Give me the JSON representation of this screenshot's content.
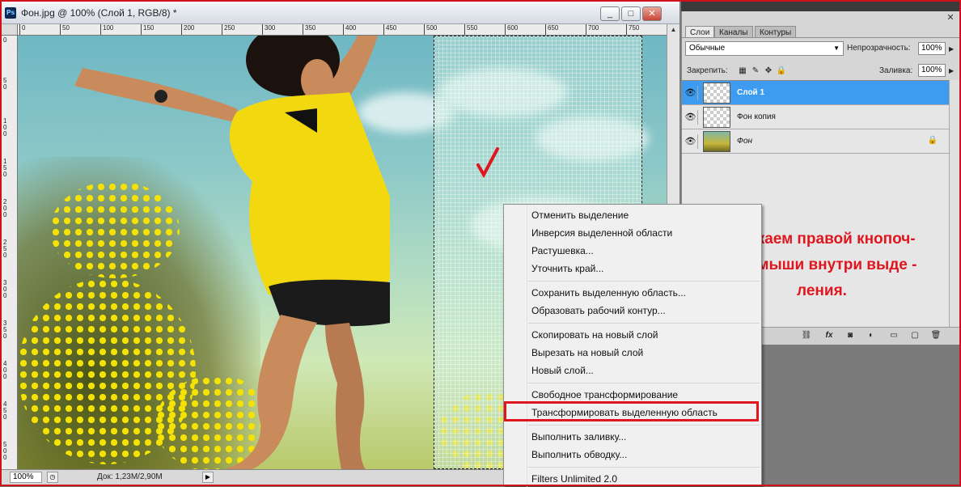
{
  "document": {
    "title": "Фон.jpg @ 100% (Слой 1, RGB/8) *",
    "app_badge": "Ps",
    "window_buttons": {
      "minimize": "_",
      "restore": "□",
      "close": "✕"
    },
    "ruler_top_ticks": [
      "0",
      "50",
      "100",
      "150",
      "200",
      "250",
      "300",
      "350",
      "400",
      "450",
      "500",
      "550",
      "600",
      "650",
      "700",
      "750"
    ],
    "ruler_left_ticks": [
      "0",
      "50",
      "100",
      "150",
      "200",
      "250",
      "300",
      "350",
      "400",
      "450",
      "500"
    ],
    "status": {
      "zoom": "100%",
      "doc_info": "Док: 1,23M/2,90M"
    }
  },
  "layers_panel": {
    "tabs": [
      "Слои",
      "Каналы",
      "Контуры"
    ],
    "active_tab": "Слои",
    "blend_mode": "Обычные",
    "opacity_label": "Непрозрачность:",
    "opacity_value": "100%",
    "lock_label": "Закрепить:",
    "fill_label": "Заливка:",
    "fill_value": "100%",
    "layers": [
      {
        "name": "Слой 1",
        "selected": true,
        "thumbnail": "transparent",
        "locked": false
      },
      {
        "name": "Фон копия",
        "selected": false,
        "thumbnail": "transparent",
        "locked": false
      },
      {
        "name": "Фон",
        "selected": false,
        "thumbnail": "photo",
        "locked": true
      }
    ],
    "close_glyph": "✕"
  },
  "annotation": {
    "lines": [
      "Кликаем правой кнопоч-",
      "кой мыши внутри выде -",
      "ления."
    ],
    "color": "#e0161e"
  },
  "context_menu": {
    "groups": [
      [
        "Отменить выделение",
        "Инверсия выделенной области",
        "Растушевка...",
        "Уточнить край..."
      ],
      [
        "Сохранить выделенную область...",
        "Образовать рабочий контур..."
      ],
      [
        "Скопировать на новый слой",
        "Вырезать на новый слой",
        "Новый слой..."
      ],
      [
        "Свободное трансформирование",
        "Трансформировать выделенную область"
      ],
      [
        "Выполнить заливку...",
        "Выполнить обводку..."
      ],
      [
        "Filters Unlimited 2.0"
      ]
    ],
    "highlighted_item": "Трансформировать выделенную область",
    "highlight_color": "#e0161e"
  },
  "colors": {
    "selected_layer": "#3d9cf0",
    "frame_border": "#d0101a"
  }
}
